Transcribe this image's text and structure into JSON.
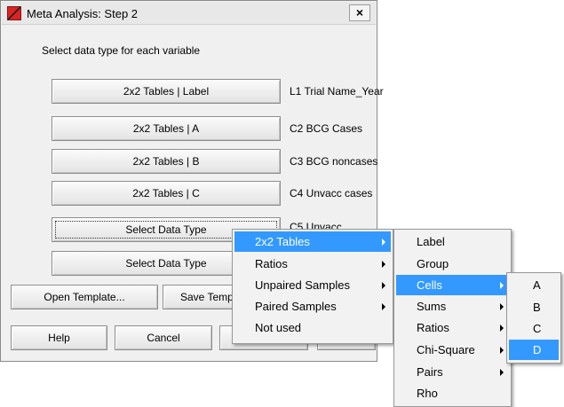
{
  "window": {
    "title": "Meta Analysis: Step 2",
    "close_label": "×"
  },
  "instruction": "Select data type for each variable",
  "rows": [
    {
      "button_label": "2x2 Tables | Label",
      "variable": "L1 Trial Name_Year"
    },
    {
      "button_label": "2x2 Tables | A",
      "variable": "C2 BCG Cases"
    },
    {
      "button_label": "2x2 Tables | B",
      "variable": "C3 BCG noncases"
    },
    {
      "button_label": "2x2 Tables | C",
      "variable": "C4 Unvacc cases"
    },
    {
      "button_label": "Select Data Type",
      "variable": "C5 Unvacc noncases"
    },
    {
      "button_label": "Select Data Type"
    }
  ],
  "bottom_buttons": {
    "open_template": "Open Template...",
    "save_template": "Save Template...",
    "help": "Help",
    "cancel": "Cancel"
  },
  "menus": {
    "level1": [
      "2x2 Tables",
      "Ratios",
      "Unpaired Samples",
      "Paired Samples",
      "Not used"
    ],
    "level2": [
      "Label",
      "Group",
      "Cells",
      "Sums",
      "Ratios",
      "Chi-Square",
      "Pairs",
      "Rho"
    ],
    "level3": [
      "A",
      "B",
      "C",
      "D"
    ]
  },
  "highlight_color": "#3399ff"
}
